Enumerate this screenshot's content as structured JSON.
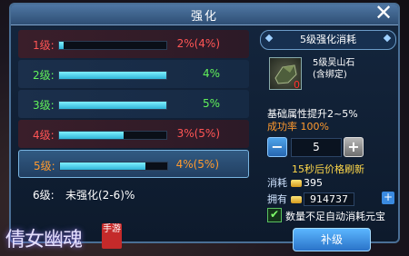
{
  "window": {
    "title": "强化",
    "close_label": "✕"
  },
  "rows": [
    {
      "label": "1级:",
      "pct": "2%(4%)",
      "color": "red",
      "fill": 0.04,
      "style": "red"
    },
    {
      "label": "2级:",
      "pct": "4%",
      "color": "green",
      "fill": 1.0,
      "style": "normal"
    },
    {
      "label": "3级:",
      "pct": "5%",
      "color": "green",
      "fill": 1.0,
      "style": "normal"
    },
    {
      "label": "4级:",
      "pct": "3%(5%)",
      "color": "red",
      "fill": 0.6,
      "style": "red"
    },
    {
      "label": "5级:",
      "pct": "4%(5%)",
      "color": "orange",
      "fill": 0.8,
      "style": "selected"
    }
  ],
  "row6": {
    "label": "6级:",
    "text": "未强化(2-6)%"
  },
  "panel": {
    "header": "5级强化消耗",
    "item_name_line1": "5级吴山石",
    "item_name_line2": "(含绑定)",
    "item_count": "0",
    "attr_boost": "基础属性提升2~5%",
    "success_rate": "成功率 100%",
    "quantity": "5",
    "minus": "−",
    "plus": "+",
    "refresh": "15秒后价格刷新",
    "cost_label": "消耗",
    "cost_value": "395",
    "own_label": "拥有",
    "own_value": "914737",
    "add": "+",
    "auto_label": "数量不足自动消耗元宝",
    "checked": "✔",
    "upgrade_button": "补级"
  },
  "logo": {
    "text": "倩女幽魂",
    "seal": "手游"
  },
  "colors": {
    "red": "#ff5555",
    "green": "#62f25a",
    "orange": "#ff9a2e",
    "accent": "#2a73c8"
  }
}
